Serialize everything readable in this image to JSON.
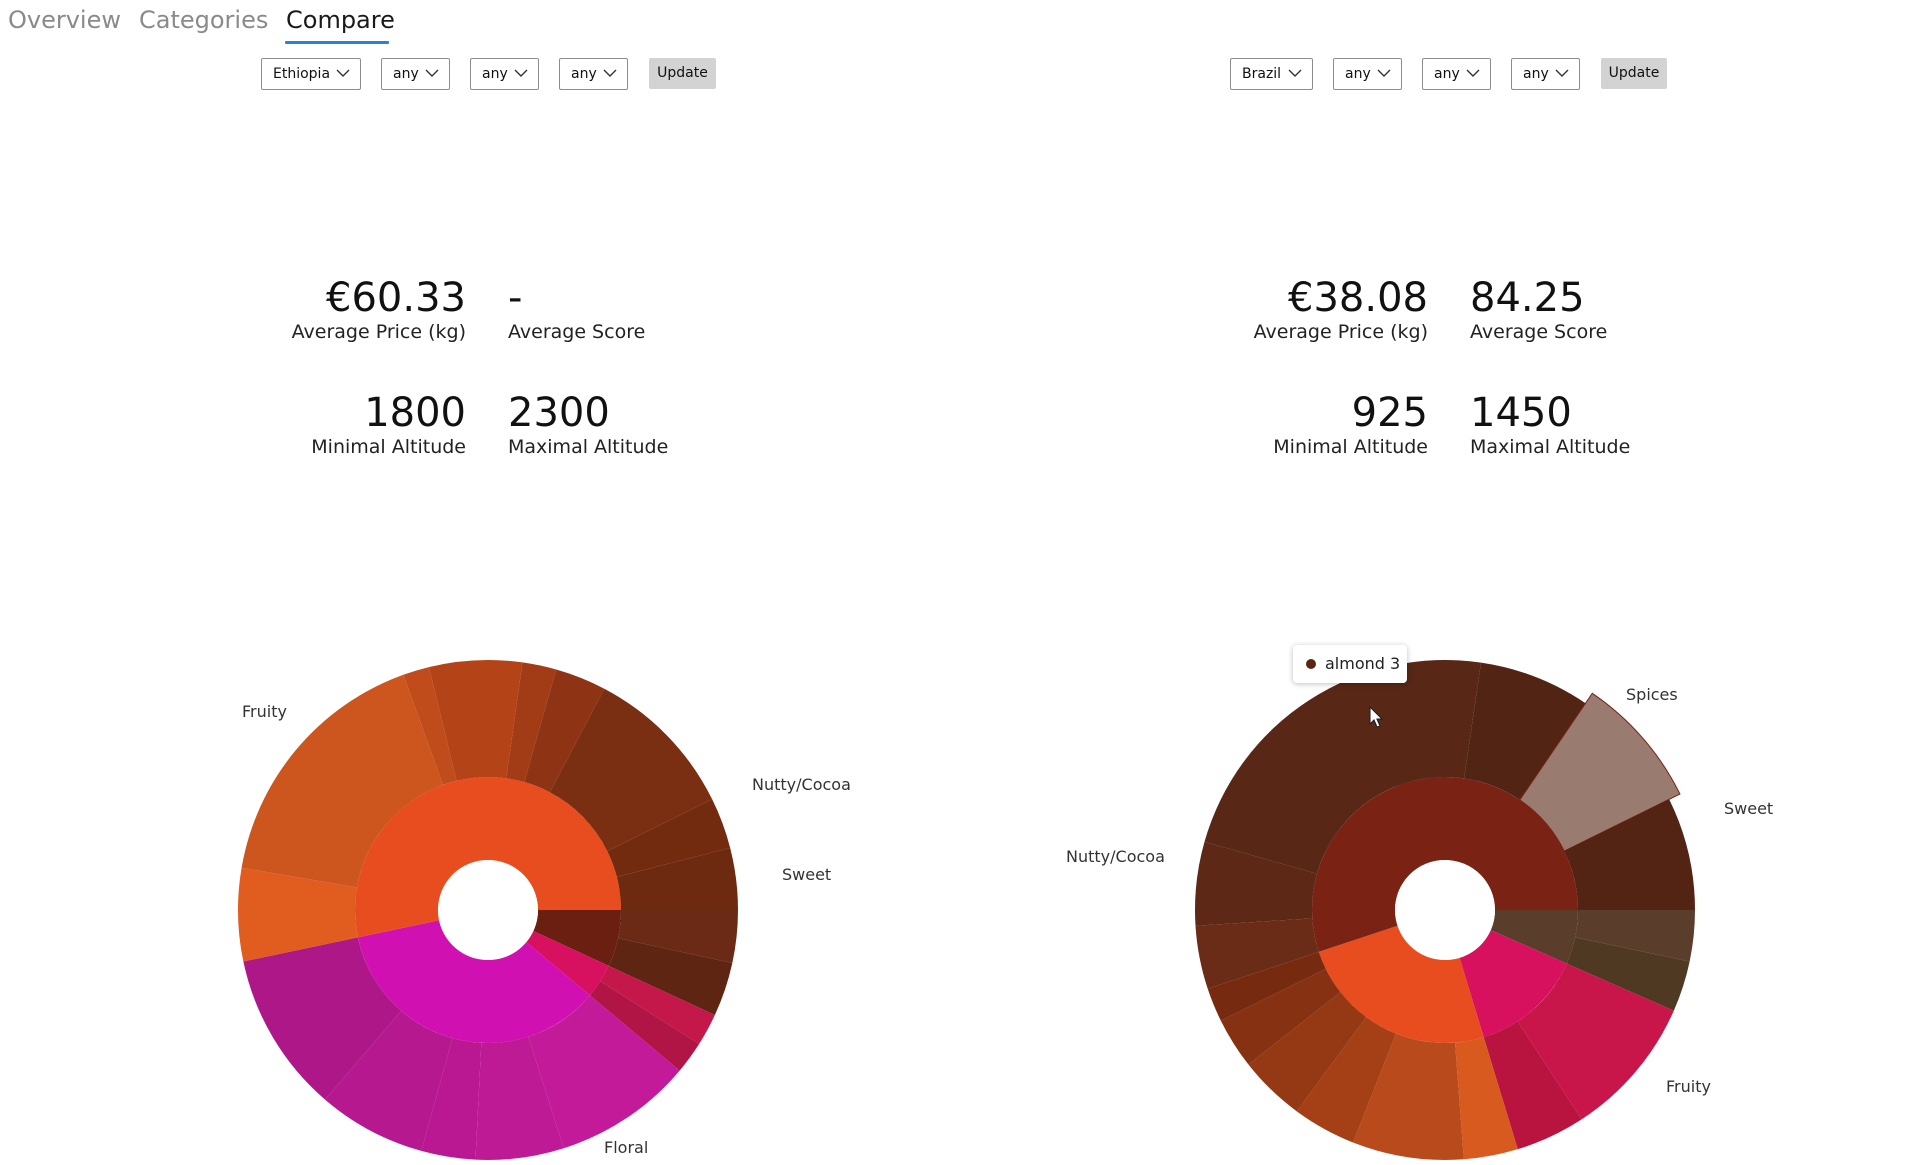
{
  "tabs": [
    {
      "label": "Overview",
      "active": false
    },
    {
      "label": "Categories",
      "active": false
    },
    {
      "label": "Compare",
      "active": true
    }
  ],
  "accent_color": "#2f7fd6",
  "left_panel": {
    "filters": [
      {
        "name": "country",
        "value": "Ethiopia"
      },
      {
        "name": "filter-2",
        "value": "any"
      },
      {
        "name": "filter-3",
        "value": "any"
      },
      {
        "name": "filter-4",
        "value": "any"
      }
    ],
    "update_label": "Update",
    "stats": {
      "avg_price": "€60.33",
      "avg_price_label": "Average Price (kg)",
      "avg_score": "-",
      "avg_score_label": "Average Score",
      "min_alt": "1800",
      "min_alt_label": "Minimal Altitude",
      "max_alt": "2300",
      "max_alt_label": "Maximal Altitude"
    },
    "chart_labels": [
      "Fruity",
      "Nutty/Cocoa",
      "Sweet",
      "Floral"
    ]
  },
  "right_panel": {
    "filters": [
      {
        "name": "country",
        "value": "Brazil"
      },
      {
        "name": "filter-2",
        "value": "any"
      },
      {
        "name": "filter-3",
        "value": "any"
      },
      {
        "name": "filter-4",
        "value": "any"
      }
    ],
    "update_label": "Update",
    "stats": {
      "avg_price": "€38.08",
      "avg_price_label": "Average Price (kg)",
      "avg_score": "84.25",
      "avg_score_label": "Average Score",
      "min_alt": "925",
      "min_alt_label": "Minimal Altitude",
      "max_alt": "1450",
      "max_alt_label": "Maximal Altitude"
    },
    "chart_labels": [
      "Spices",
      "Sweet",
      "Nutty/Cocoa",
      "Fruity"
    ],
    "tooltip": {
      "text": "almond 3",
      "dot_color": "#5a2614"
    }
  },
  "chart_data": [
    {
      "type": "sunburst",
      "categories": [
        {
          "name": "Nutty/Cocoa",
          "share": 0.069,
          "color": "#6a1f10",
          "children": [
            {
              "share": 0.034,
              "color": "#6a2a16"
            },
            {
              "share": 0.035,
              "color": "#5e2513"
            }
          ]
        },
        {
          "name": "Sweet",
          "share": 0.042,
          "color": "#d81060",
          "children": [
            {
              "share": 0.021,
              "color": "#c4174a"
            },
            {
              "share": 0.021,
              "color": "#b11545"
            }
          ]
        },
        {
          "name": "Floral",
          "share": 0.356,
          "color": "#d010b0",
          "children": [
            {
              "share": 0.09,
              "color": "#c21a98"
            },
            {
              "share": 0.057,
              "color": "#bf1a96"
            },
            {
              "share": 0.035,
              "color": "#ba1792"
            },
            {
              "share": 0.07,
              "color": "#b5188f"
            },
            {
              "share": 0.104,
              "color": "#ae1788"
            }
          ]
        },
        {
          "name": "Fruity",
          "share": 0.533,
          "color": "#e84d20",
          "children": [
            {
              "share": 0.06,
              "color": "#e05c1f"
            },
            {
              "share": 0.168,
              "color": "#cd561f"
            },
            {
              "share": 0.017,
              "color": "#c14c1b"
            },
            {
              "share": 0.06,
              "color": "#b44418"
            },
            {
              "share": 0.022,
              "color": "#a23c16"
            },
            {
              "share": 0.033,
              "color": "#8e3314"
            },
            {
              "share": 0.1,
              "color": "#7a2f12"
            },
            {
              "share": 0.033,
              "color": "#732b10"
            },
            {
              "share": 0.04,
              "color": "#6e2a10"
            }
          ]
        }
      ]
    },
    {
      "type": "sunburst",
      "categories": [
        {
          "name": "Spices",
          "share": 0.066,
          "color": "#5a3e2b",
          "children": [
            {
              "share": 0.033,
              "color": "#5a3e2b"
            },
            {
              "share": 0.033,
              "color": "#4f3923"
            }
          ]
        },
        {
          "name": "Sweet",
          "share": 0.137,
          "color": "#d8115e",
          "children": [
            {
              "share": 0.092,
              "color": "#c9164a"
            },
            {
              "share": 0.045,
              "color": "#b8143f"
            }
          ]
        },
        {
          "name": "Fruity",
          "share": 0.246,
          "color": "#e84d20",
          "children": [
            {
              "share": 0.035,
              "color": "#d95a1f"
            },
            {
              "share": 0.072,
              "color": "#b94a1b"
            },
            {
              "share": 0.041,
              "color": "#a43f16"
            },
            {
              "share": 0.043,
              "color": "#953814"
            },
            {
              "share": 0.033,
              "color": "#853112"
            },
            {
              "share": 0.022,
              "color": "#762a10"
            }
          ]
        },
        {
          "name": "Nutty/Cocoa",
          "share": 0.551,
          "color": "#7a2213",
          "children": [
            {
              "share": 0.041,
              "color": "#6a2c17"
            },
            {
              "share": 0.054,
              "color": "#5e2816"
            },
            {
              "share": 0.229,
              "color": "#582715"
            },
            {
              "share": 0.072,
              "color": "#522414"
            },
            {
              "share": 0.082,
              "color": "#9a7b70",
              "highlight": true,
              "label": "almond 3"
            },
            {
              "share": 0.073,
              "color": "#532313"
            }
          ]
        }
      ]
    }
  ]
}
